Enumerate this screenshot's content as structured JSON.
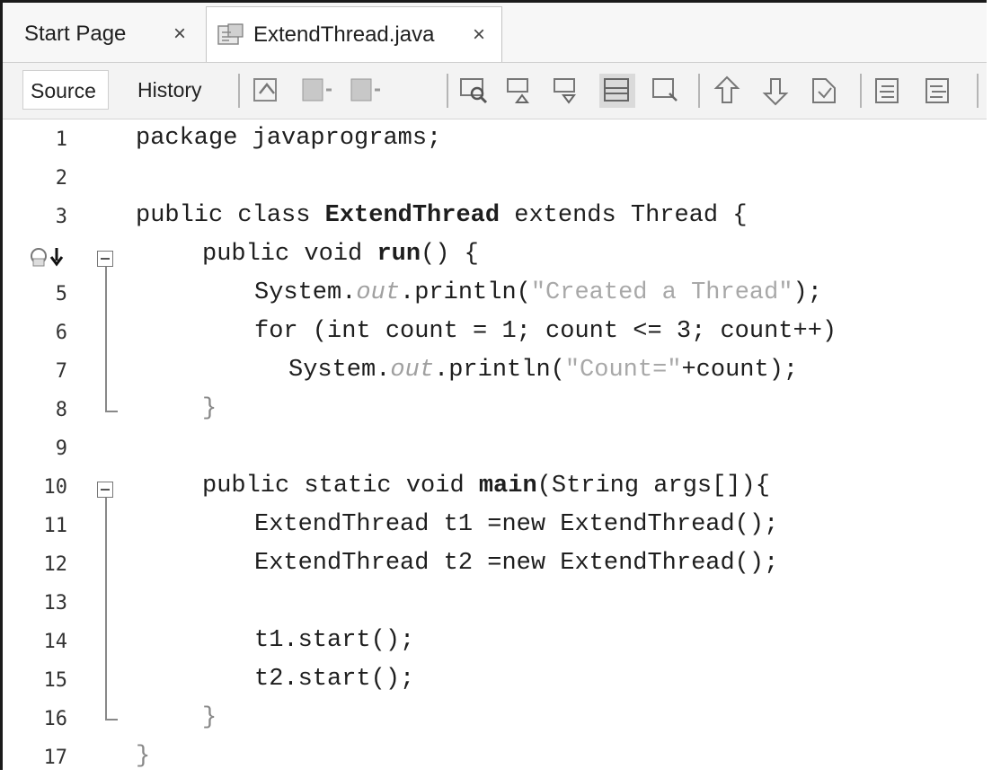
{
  "tabs": [
    {
      "label": "Start Page",
      "close": "×"
    },
    {
      "label": "ExtendThread.java",
      "close": "×"
    }
  ],
  "toolbar": {
    "source_label": "Source",
    "history_label": "History",
    "icons": [
      "last-edit-icon",
      "back-icon",
      "forward-icon",
      "find-selection-icon",
      "find-previous-icon",
      "find-next-icon",
      "toggle-highlight-icon",
      "toggle-rect-selection-icon",
      "previous-bookmark-icon",
      "next-bookmark-icon",
      "toggle-bookmark-icon",
      "shift-left-icon",
      "shift-right-icon"
    ]
  },
  "editor": {
    "lines": [
      {
        "n": "1"
      },
      {
        "n": "2"
      },
      {
        "n": "3"
      },
      {
        "n": "4"
      },
      {
        "n": "5"
      },
      {
        "n": "6"
      },
      {
        "n": "7"
      },
      {
        "n": "8"
      },
      {
        "n": "9"
      },
      {
        "n": "10"
      },
      {
        "n": "11"
      },
      {
        "n": "12"
      },
      {
        "n": "13"
      },
      {
        "n": "14"
      },
      {
        "n": "15"
      },
      {
        "n": "16"
      },
      {
        "n": "17"
      }
    ],
    "code": {
      "l1": "package javaprograms;",
      "l3a": "public class ",
      "l3b": "ExtendThread",
      "l3c": " extends Thread {",
      "l4a": "public void ",
      "l4b": "run",
      "l4c": "() {",
      "l5a": "System.",
      "l5b": "out",
      "l5c": ".println(",
      "l5d": "\"Created a Thread\"",
      "l5e": ");",
      "l6": "for (int count = 1; count <= 3; count++)",
      "l7a": "System.",
      "l7b": "out",
      "l7c": ".println(",
      "l7d": "\"Count=\"",
      "l7e": "+count);",
      "l8": "}",
      "l10a": "public static void ",
      "l10b": "main",
      "l10c": "(String args[]){",
      "l11": "ExtendThread t1 =new ExtendThread();",
      "l12": "ExtendThread t2 =new ExtendThread();",
      "l14": "t1.start();",
      "l15": "t2.start();",
      "l16": "}",
      "l17": "}"
    }
  }
}
